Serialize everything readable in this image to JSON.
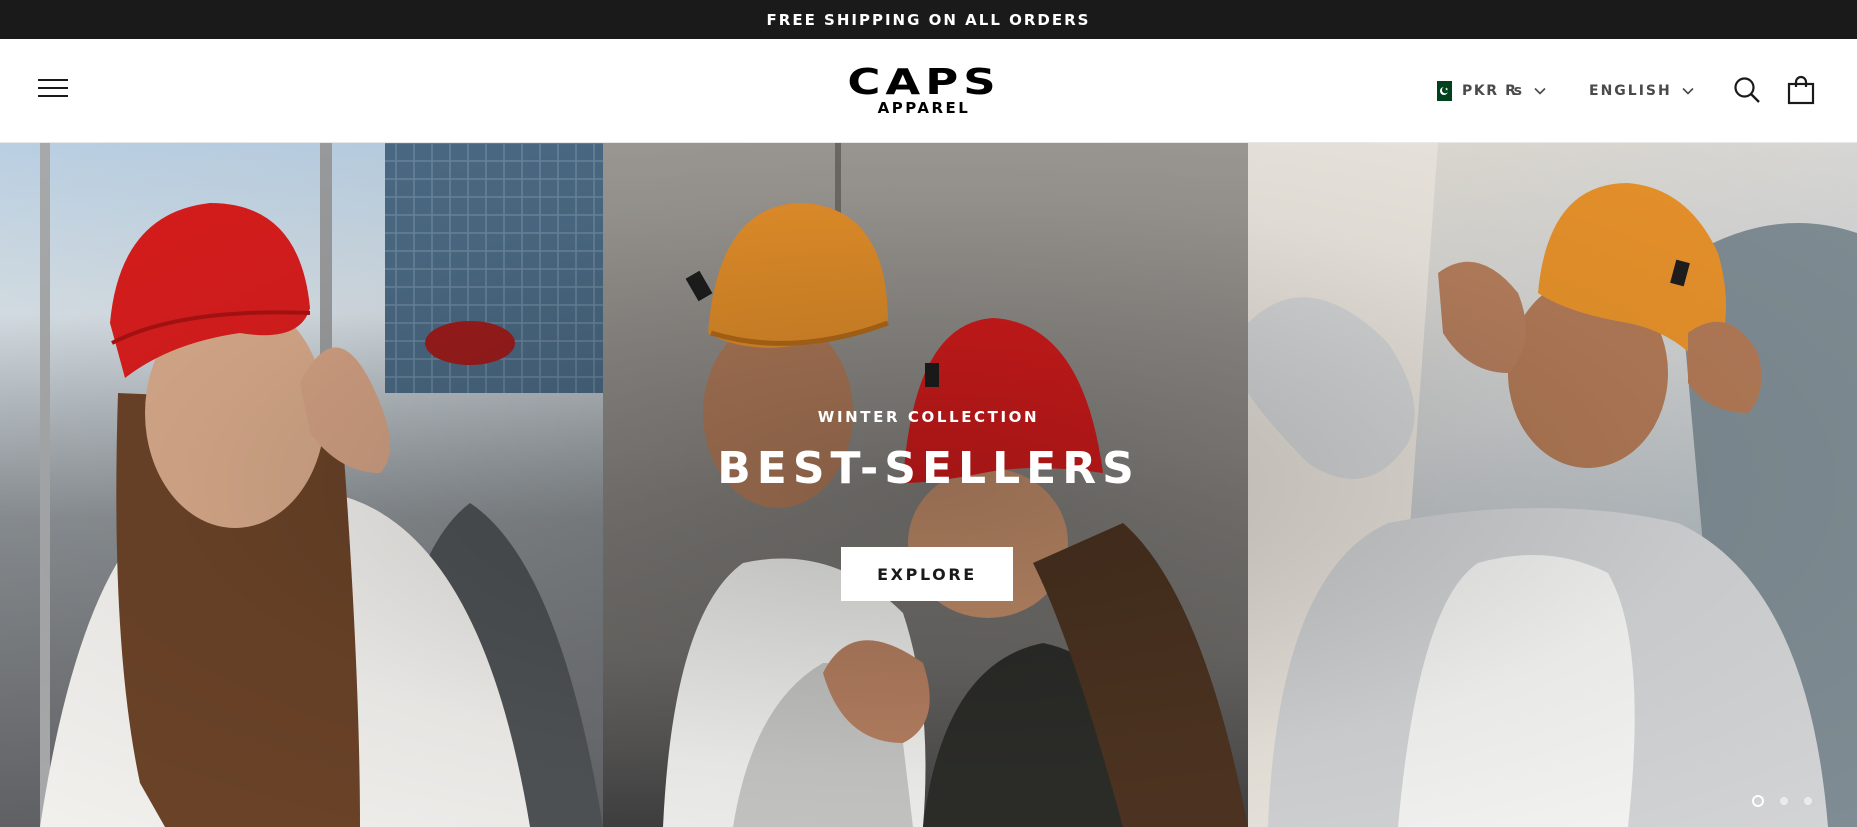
{
  "announcement": {
    "text": "FREE SHIPPING ON ALL ORDERS"
  },
  "header": {
    "logo": {
      "main": "CAPS",
      "sub": "APPAREL"
    },
    "currency": {
      "label": "PKR ₨",
      "flag_icon": "pakistan-flag-icon"
    },
    "language": {
      "label": "ENGLISH"
    },
    "icons": [
      "menu-icon",
      "search-icon",
      "shopping-bag-icon",
      "chevron-down-icon"
    ]
  },
  "hero": {
    "subtitle": "WINTER COLLECTION",
    "title": "BEST-SELLERS",
    "button_label": "EXPLORE",
    "slides": {
      "count": 3,
      "active_index": 0
    }
  },
  "colors": {
    "announcement_bg": "#1a1a1a",
    "text": "#1a1a1a",
    "header_bg": "#ffffff",
    "button_bg": "#ffffff",
    "flag_green": "#01411c"
  }
}
